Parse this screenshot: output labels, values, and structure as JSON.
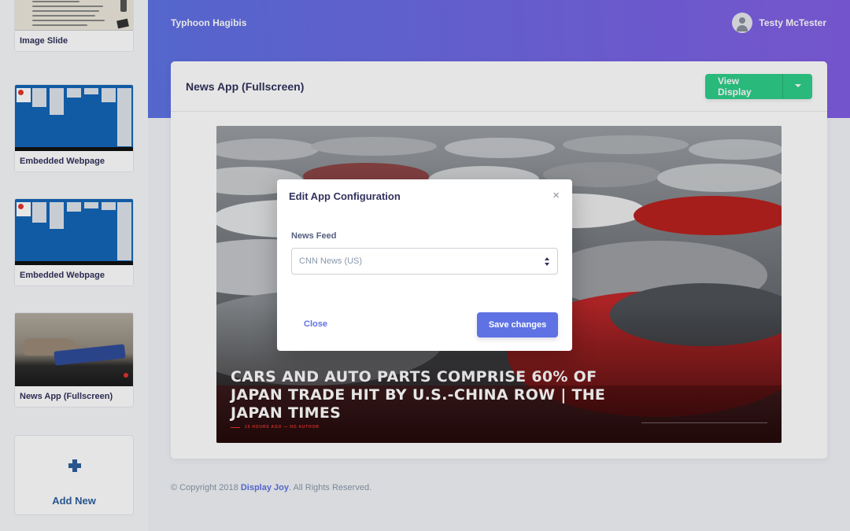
{
  "header": {
    "brand": "Typhoon Hagibis",
    "user_name": "Testy McTester"
  },
  "sidebar": {
    "items": [
      {
        "label": "Image Slide"
      },
      {
        "label": "Embedded Webpage"
      },
      {
        "label": "Embedded Webpage"
      },
      {
        "label": "News App (Fullscreen)"
      }
    ],
    "add_new": "Add New"
  },
  "main": {
    "title": "News App (Fullscreen)",
    "view_display_label": "View Display"
  },
  "preview": {
    "headline": "Cars and auto parts comprise 60% of Japan trade hit by U.S.-China row | The Japan Times",
    "meta": "15 HOURS AGO — NO AUTHOR"
  },
  "modal": {
    "title": "Edit App Configuration",
    "close_glyph": "×",
    "field_label": "News Feed",
    "select_value": "CNN News (US)",
    "close_button": "Close",
    "save_button": "Save changes"
  },
  "footer": {
    "prefix": "© Copyright 2018 ",
    "link": "Display Joy",
    "suffix": ". All Rights Reserved."
  },
  "colors": {
    "accent": "#5e72e4",
    "success": "#2dce89",
    "danger": "#e0352b"
  }
}
